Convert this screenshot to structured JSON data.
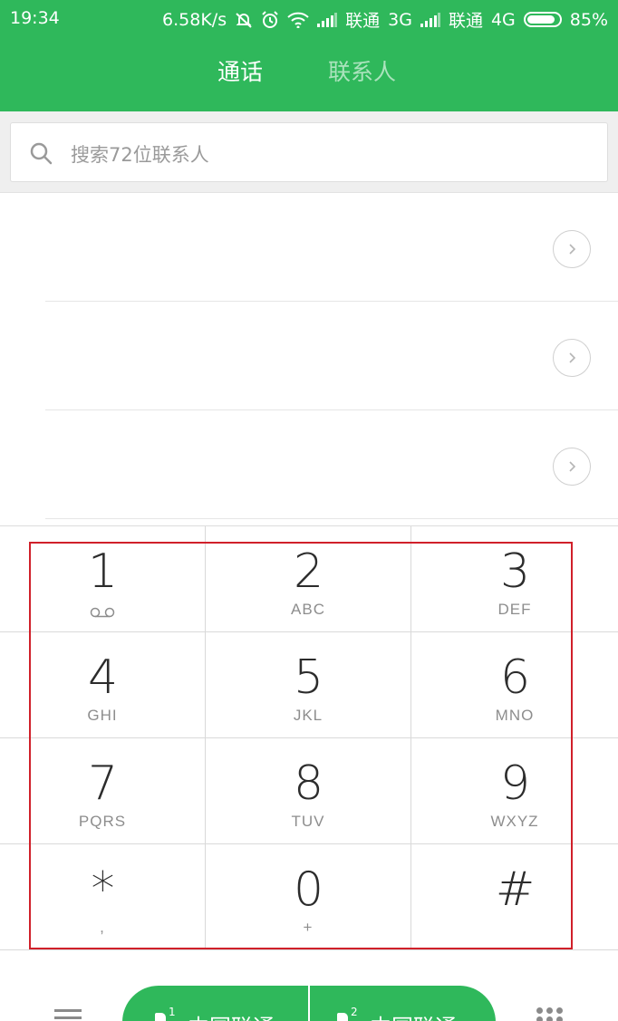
{
  "status_bar": {
    "time": "19:34",
    "net_speed": "6.58K/s",
    "carrier1": "联通",
    "net1": "3G",
    "carrier2": "联通",
    "net2": "4G",
    "battery": "85%"
  },
  "tabs": {
    "calls": "通话",
    "contacts": "联系人"
  },
  "search": {
    "placeholder": "搜索72位联系人"
  },
  "recent_rows": [
    {
      "info_icon": "chevron-right-icon"
    },
    {
      "info_icon": "chevron-right-icon"
    },
    {
      "info_icon": "chevron-right-icon"
    }
  ],
  "keypad": [
    {
      "digit": "1",
      "sub": ""
    },
    {
      "digit": "2",
      "sub": "ABC"
    },
    {
      "digit": "3",
      "sub": "DEF"
    },
    {
      "digit": "4",
      "sub": "GHI"
    },
    {
      "digit": "5",
      "sub": "JKL"
    },
    {
      "digit": "6",
      "sub": "MNO"
    },
    {
      "digit": "7",
      "sub": "PQRS"
    },
    {
      "digit": "8",
      "sub": "TUV"
    },
    {
      "digit": "9",
      "sub": "WXYZ"
    },
    {
      "digit": "*",
      "sub": ","
    },
    {
      "digit": "0",
      "sub": "+"
    },
    {
      "digit": "#",
      "sub": ""
    }
  ],
  "call_buttons": {
    "sim1_label": "中国联通",
    "sim1_index": "1",
    "sim2_label": "中国联通",
    "sim2_index": "2"
  },
  "colors": {
    "accent": "#2fb85b",
    "highlight_border": "#d0202a"
  }
}
